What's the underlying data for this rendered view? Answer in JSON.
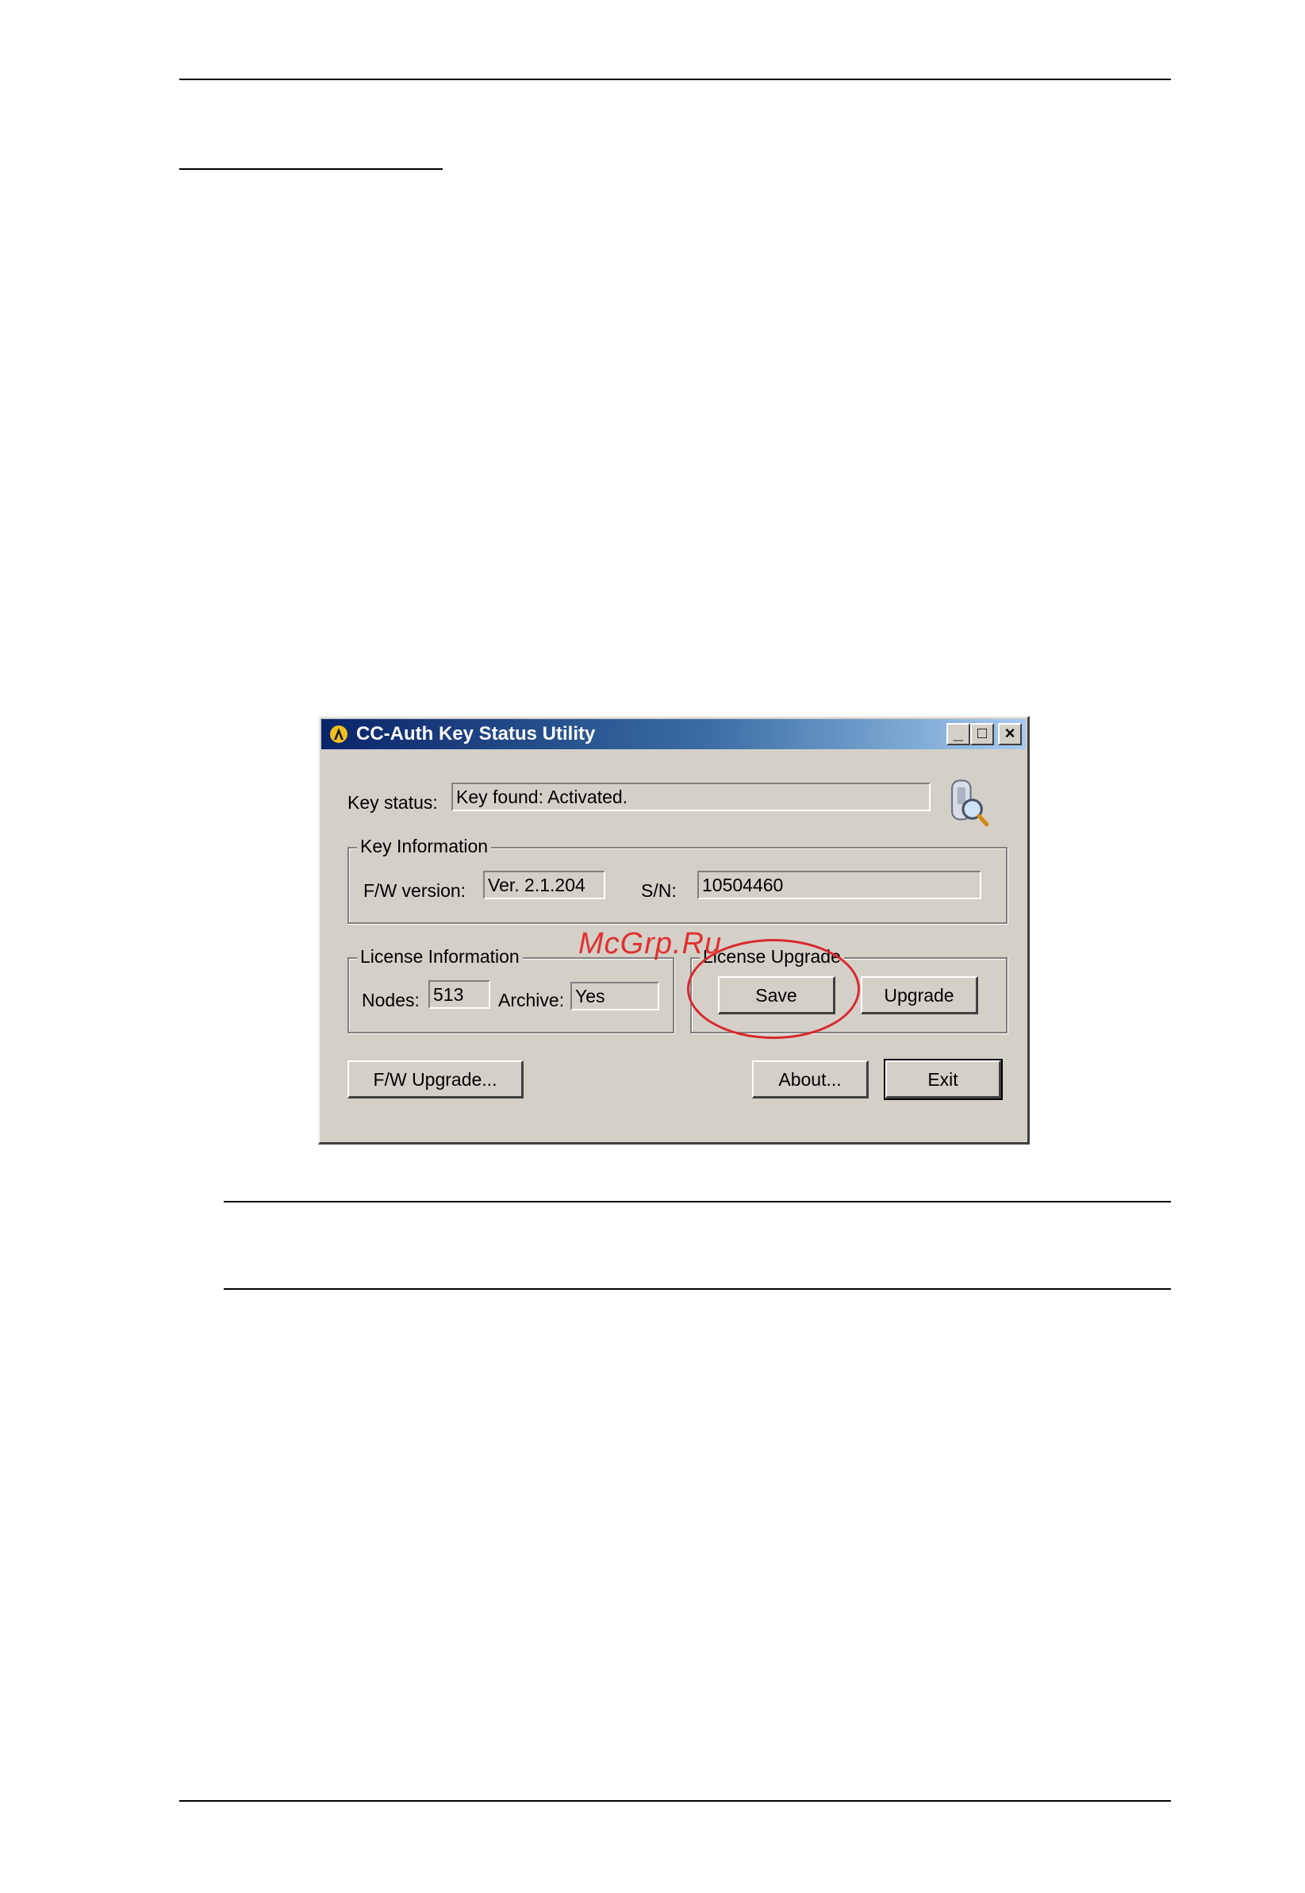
{
  "window": {
    "title": "CC-Auth Key Status Utility",
    "minimize": "_",
    "maximize": "□",
    "close": "×"
  },
  "key_status": {
    "label": "Key status:",
    "value": "Key found: Activated."
  },
  "key_information": {
    "legend": "Key Information",
    "fw_version_label": "F/W version:",
    "fw_version_value": "Ver. 2.1.204",
    "sn_label": "S/N:",
    "sn_value": "10504460"
  },
  "license_information": {
    "legend": "License Information",
    "nodes_label": "Nodes:",
    "nodes_value": "513",
    "archive_label": "Archive:",
    "archive_value": "Yes"
  },
  "license_upgrade": {
    "legend": "License Upgrade",
    "save_label": "Save",
    "upgrade_label": "Upgrade"
  },
  "buttons": {
    "fw_upgrade": "F/W Upgrade...",
    "about": "About...",
    "exit": "Exit"
  },
  "watermark": "McGrp.Ru",
  "colors": {
    "highlight_circle": "#d8282c",
    "watermark": "#e03030"
  }
}
